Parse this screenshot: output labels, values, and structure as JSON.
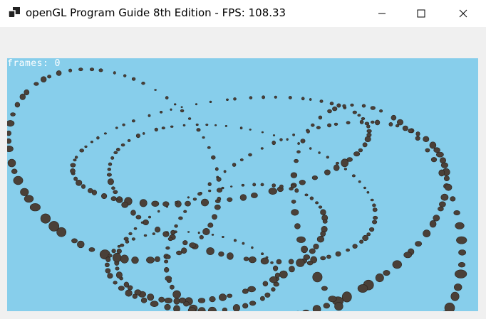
{
  "window": {
    "title": "openGL Program Guide 8th Edition - FPS: 108.33",
    "icon": "window-app-icon",
    "controls": {
      "minimize_icon": "minimize-icon",
      "maximize_icon": "maximize-icon",
      "close_icon": "close-icon"
    }
  },
  "viewport": {
    "background_color": "#87ceeb",
    "overlay_text": "frames: 0",
    "object_color": "#4a4038"
  }
}
